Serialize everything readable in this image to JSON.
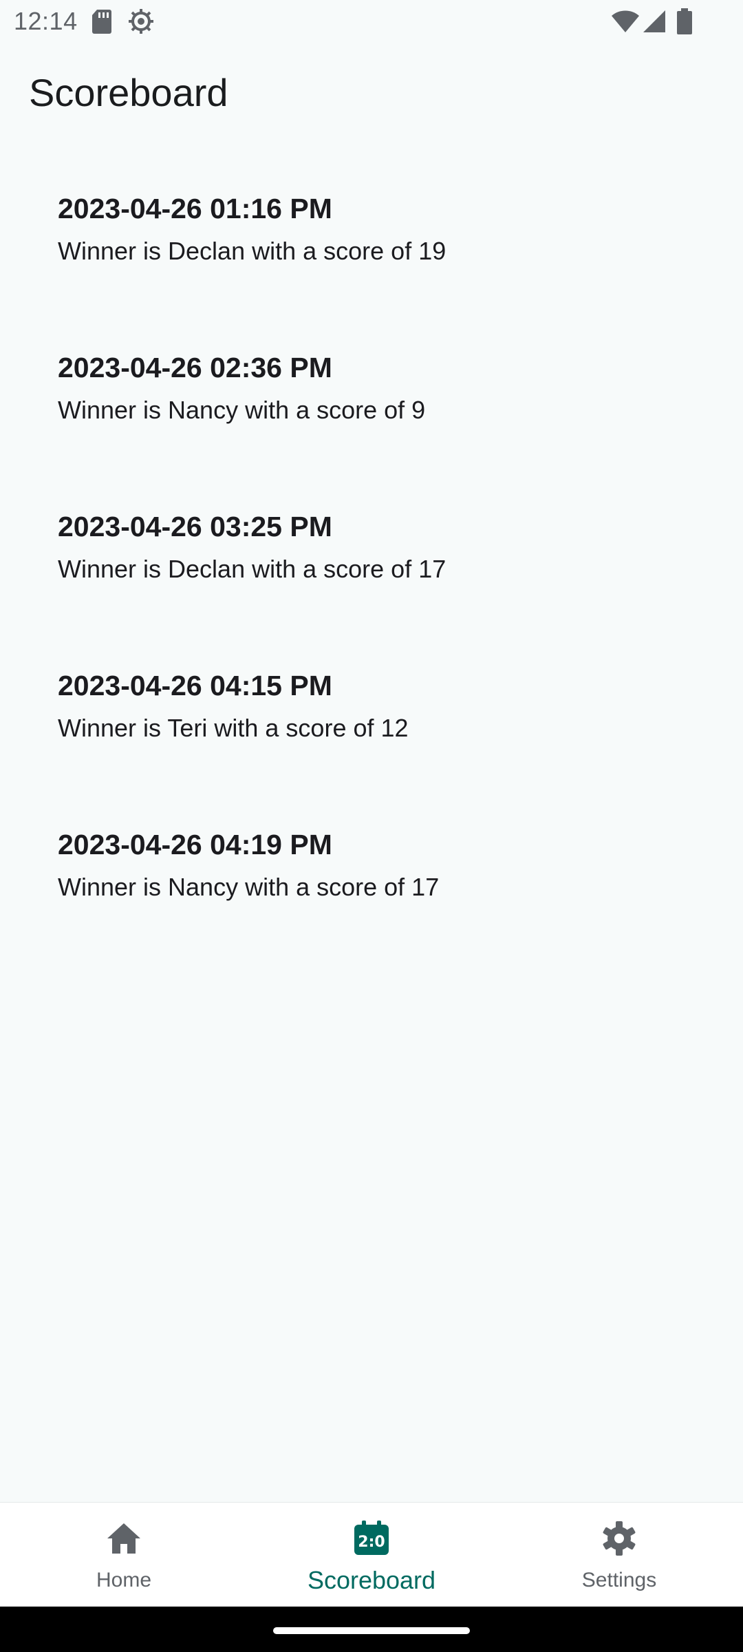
{
  "status_bar": {
    "time": "12:14",
    "icons": [
      "sd-card-icon",
      "debug-icon",
      "wifi-icon",
      "signal-icon",
      "battery-icon"
    ]
  },
  "app_bar": {
    "title": "Scoreboard"
  },
  "scores": [
    {
      "datetime": "2023-04-26 01:16 PM",
      "summary": "Winner is Declan with a score of 19"
    },
    {
      "datetime": "2023-04-26 02:36 PM",
      "summary": "Winner is Nancy with a score of 9"
    },
    {
      "datetime": "2023-04-26 03:25 PM",
      "summary": "Winner is Declan with a score of 17"
    },
    {
      "datetime": "2023-04-26 04:15 PM",
      "summary": "Winner is Teri with a score of 12"
    },
    {
      "datetime": "2023-04-26 04:19 PM",
      "summary": "Winner is Nancy with a score of 17"
    }
  ],
  "bottom_nav": {
    "items": [
      {
        "label": "Home",
        "icon": "home-icon",
        "active": false
      },
      {
        "label": "Scoreboard",
        "icon": "scoreboard-icon",
        "active": true
      },
      {
        "label": "Settings",
        "icon": "settings-icon",
        "active": false
      }
    ]
  },
  "colors": {
    "background": "#f7fafa",
    "accent": "#006a60",
    "inactive": "#5f6368"
  }
}
